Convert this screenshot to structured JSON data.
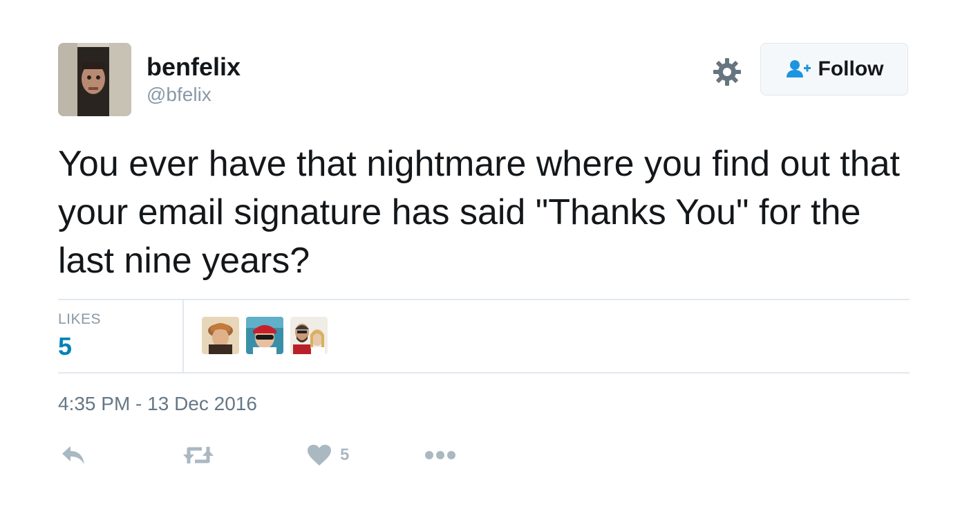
{
  "user": {
    "display_name": "benfelix",
    "handle": "@bfelix"
  },
  "follow_button": {
    "label": "Follow"
  },
  "tweet": {
    "text": "You ever have that nightmare where you find out that your email signature has said \"Thanks You\" for the last nine years?"
  },
  "stats": {
    "likes_label": "LIKES",
    "likes_count": "5"
  },
  "timestamp": "4:35 PM - 13 Dec 2016",
  "actions": {
    "like_count": "5"
  },
  "colors": {
    "accent": "#1b95e0",
    "likes_count": "#0084b4",
    "muted": "#8899a6",
    "action_icon": "#aab8c2"
  },
  "icons": [
    "gear-icon",
    "follow-person-plus-icon",
    "reply-icon",
    "retweet-icon",
    "heart-icon",
    "more-dots-icon"
  ]
}
